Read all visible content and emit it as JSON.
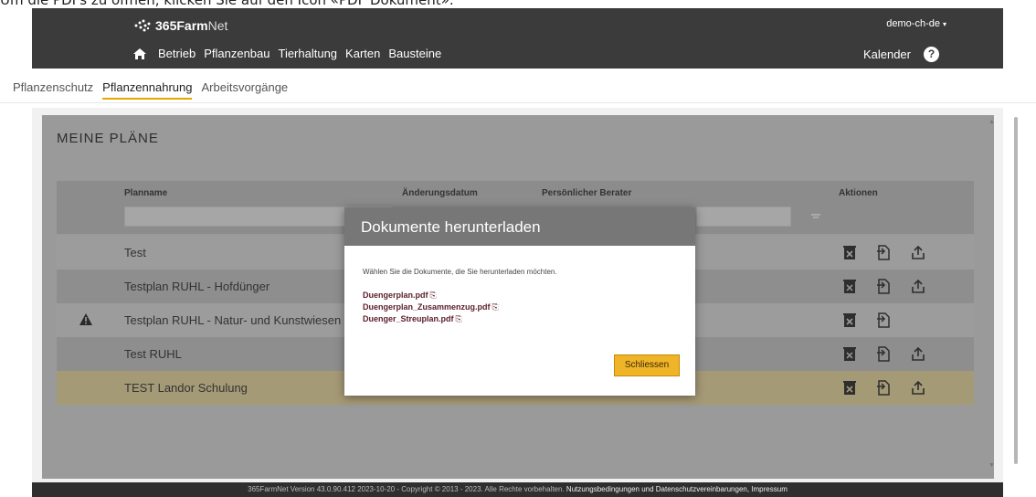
{
  "instruction": "Um die PDFs zu öffnen, klicken Sie auf den Icon «PDF Dokument».",
  "header": {
    "brand_bold": "365Farm",
    "brand_thin": "Net",
    "user": "demo-ch-de",
    "nav": [
      "Betrieb",
      "Pflanzenbau",
      "Tierhaltung",
      "Karten",
      "Bausteine"
    ],
    "calendar": "Kalender",
    "help": "?"
  },
  "subtabs": [
    "Pflanzenschutz",
    "Pflanzennahrung",
    "Arbeitsvorgänge"
  ],
  "panel": {
    "title": "MEINE PLÄNE",
    "columns": {
      "planname": "Planname",
      "changed": "Änderungsdatum",
      "advisor": "Persönlicher Berater",
      "actions": "Aktionen"
    },
    "rows": [
      {
        "name": "Test",
        "warning": false,
        "upload": true
      },
      {
        "name": "Testplan RUHL - Hofdünger",
        "warning": false,
        "upload": true
      },
      {
        "name": "Testplan RUHL - Natur- und Kunstwiesen",
        "warning": true,
        "upload": false
      },
      {
        "name": "Test RUHL",
        "warning": false,
        "upload": true
      },
      {
        "name": "TEST Landor Schulung",
        "warning": false,
        "upload": true
      }
    ]
  },
  "modal": {
    "title": "Dokumente herunterladen",
    "text": "Wählen Sie die Dokumente, die Sie herunterladen möchten.",
    "documents": [
      "Duengerplan.pdf",
      "Duengerplan_Zusammenzug.pdf",
      "Duenger_Streuplan.pdf"
    ],
    "close_label": "Schliessen"
  },
  "footer": {
    "text": "365FarmNet Version 43.0.90.412 2023-10-20 - Copyright © 2013 - 2023. Alle Rechte vorbehalten.",
    "links": "Nutzungsbedingungen und Datenschutzvereinbarungen, Impressum"
  },
  "colors": {
    "accent": "#e8a400",
    "button": "#f0b429",
    "topbar": "#3b3b3b",
    "link": "#5a1e2a"
  }
}
